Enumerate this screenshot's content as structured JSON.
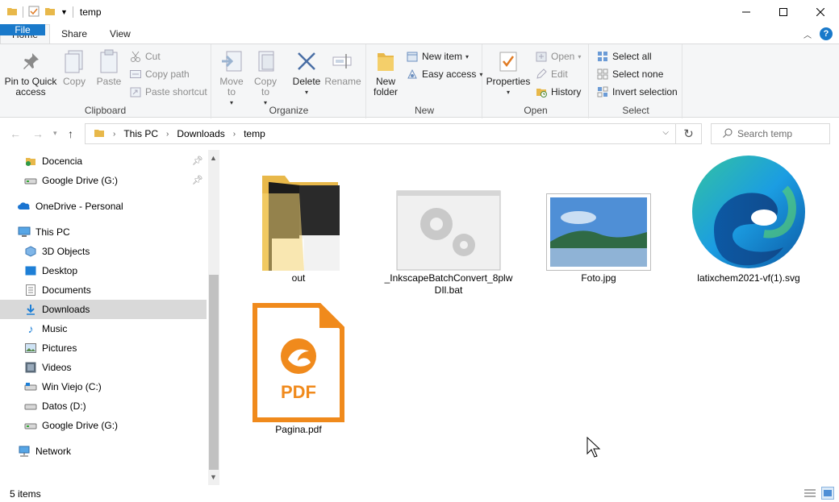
{
  "window": {
    "title": "temp"
  },
  "ribbon_tabs": [
    "File",
    "Home",
    "Share",
    "View"
  ],
  "active_tab": "Home",
  "clipboard": {
    "group": "Clipboard",
    "pin": "Pin to Quick access",
    "copy": "Copy",
    "paste": "Paste",
    "cut": "Cut",
    "copy_path": "Copy path",
    "paste_shortcut": "Paste shortcut"
  },
  "organize": {
    "group": "Organize",
    "move_to": "Move to",
    "copy_to": "Copy to",
    "delete": "Delete",
    "rename": "Rename"
  },
  "new": {
    "group": "New",
    "new_folder": "New folder",
    "new_item": "New item",
    "easy_access": "Easy access"
  },
  "open": {
    "group": "Open",
    "properties": "Properties",
    "open": "Open",
    "edit": "Edit",
    "history": "History"
  },
  "select": {
    "group": "Select",
    "select_all": "Select all",
    "select_none": "Select none",
    "invert": "Invert selection"
  },
  "address": {
    "crumbs": [
      "This PC",
      "Downloads",
      "temp"
    ]
  },
  "search": {
    "placeholder": "Search temp"
  },
  "nav": {
    "items": [
      {
        "label": "Docencia",
        "icon": "folder-icon",
        "pinned": true
      },
      {
        "label": "Google Drive (G:)",
        "icon": "drive-icon",
        "pinned": true
      },
      {
        "label": "OneDrive - Personal",
        "icon": "onedrive-icon"
      },
      {
        "label": "This PC",
        "icon": "pc-icon"
      },
      {
        "label": "3D Objects",
        "icon": "3d-objects-icon"
      },
      {
        "label": "Desktop",
        "icon": "desktop-icon"
      },
      {
        "label": "Documents",
        "icon": "documents-icon"
      },
      {
        "label": "Downloads",
        "icon": "downloads-icon",
        "selected": true
      },
      {
        "label": "Music",
        "icon": "music-icon"
      },
      {
        "label": "Pictures",
        "icon": "pictures-icon"
      },
      {
        "label": "Videos",
        "icon": "videos-icon"
      },
      {
        "label": "Win Viejo (C:)",
        "icon": "drive-icon"
      },
      {
        "label": "Datos (D:)",
        "icon": "drive-icon"
      },
      {
        "label": "Google Drive (G:)",
        "icon": "drive-icon"
      },
      {
        "label": "Network",
        "icon": "network-icon"
      }
    ]
  },
  "files": [
    {
      "name": "out",
      "icon": "folder-icon"
    },
    {
      "name": "_InkscapeBatchConvert_8plwDIl.bat",
      "icon": "batch-file-icon"
    },
    {
      "name": "Foto.jpg",
      "icon": "image-file-icon"
    },
    {
      "name": "latixchem2021-vf(1).svg",
      "icon": "edge-icon"
    },
    {
      "name": "Pagina.pdf",
      "icon": "pdf-icon"
    }
  ],
  "pdf_badge": "PDF",
  "status": {
    "count": "5 items"
  }
}
